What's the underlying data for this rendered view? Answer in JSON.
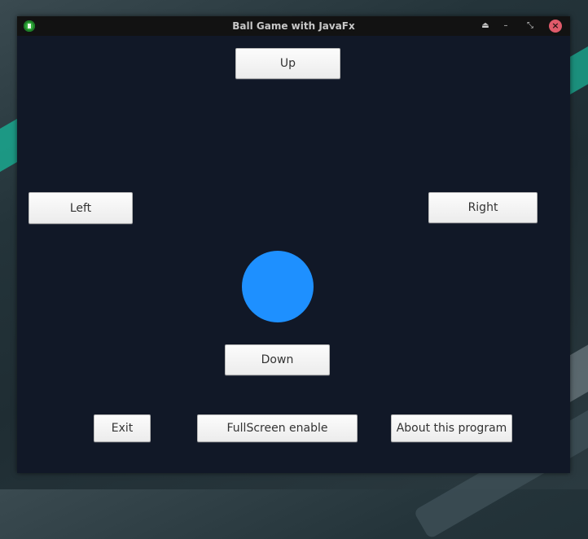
{
  "window": {
    "title": "Ball Game with JavaFx",
    "controls": [
      "eject-icon",
      "minimize-icon",
      "restore-icon",
      "close-icon"
    ]
  },
  "buttons": {
    "up": "Up",
    "left": "Left",
    "right": "Right",
    "down": "Down",
    "exit": "Exit",
    "fullscreen": "FullScreen enable",
    "about": "About this program"
  },
  "colors": {
    "background": "#111827",
    "ball": "#1e90ff",
    "close_button": "#e05a6a"
  }
}
